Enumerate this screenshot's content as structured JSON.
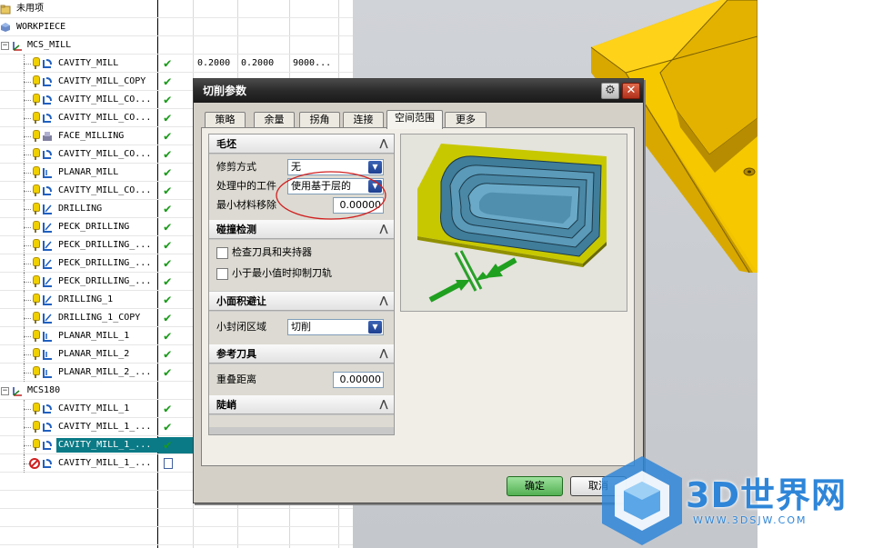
{
  "navigator": {
    "rows": [
      {
        "name": "未用项",
        "type": "folder",
        "indent": 0
      },
      {
        "name": "WORKPIECE",
        "type": "workpiece",
        "indent": 0
      },
      {
        "name": "MCS_MILL",
        "type": "mcs",
        "indent": 0,
        "expander": "−"
      },
      {
        "name": "CAVITY_MILL",
        "type": "cavity",
        "indent": 2,
        "check": "✔",
        "v1": "0.2000",
        "v2": "0.2000",
        "v3": "9000..."
      },
      {
        "name": "CAVITY_MILL_COPY",
        "type": "cavity",
        "indent": 2,
        "check": "✔"
      },
      {
        "name": "CAVITY_MILL_CO...",
        "type": "cavity",
        "indent": 2,
        "check": "✔"
      },
      {
        "name": "CAVITY_MILL_CO...",
        "type": "cavity",
        "indent": 2,
        "check": "✔"
      },
      {
        "name": "FACE_MILLING",
        "type": "face",
        "indent": 2,
        "check": "✔"
      },
      {
        "name": "CAVITY_MILL_CO...",
        "type": "cavity",
        "indent": 2,
        "check": "✔"
      },
      {
        "name": "PLANAR_MILL",
        "type": "planar",
        "indent": 2,
        "check": "✔"
      },
      {
        "name": "CAVITY_MILL_CO...",
        "type": "cavity",
        "indent": 2,
        "check": "✔"
      },
      {
        "name": "DRILLING",
        "type": "drill",
        "indent": 2,
        "check": "✔"
      },
      {
        "name": "PECK_DRILLING",
        "type": "drill",
        "indent": 2,
        "check": "✔"
      },
      {
        "name": "PECK_DRILLING_...",
        "type": "drill",
        "indent": 2,
        "check": "✔"
      },
      {
        "name": "PECK_DRILLING_...",
        "type": "drill",
        "indent": 2,
        "check": "✔"
      },
      {
        "name": "PECK_DRILLING_...",
        "type": "drill",
        "indent": 2,
        "check": "✔"
      },
      {
        "name": "DRILLING_1",
        "type": "drill",
        "indent": 2,
        "check": "✔"
      },
      {
        "name": "DRILLING_1_COPY",
        "type": "drill",
        "indent": 2,
        "check": "✔"
      },
      {
        "name": "PLANAR_MILL_1",
        "type": "planar",
        "indent": 2,
        "check": "✔"
      },
      {
        "name": "PLANAR_MILL_2",
        "type": "planar",
        "indent": 2,
        "check": "✔"
      },
      {
        "name": "PLANAR_MILL_2_...",
        "type": "planar",
        "indent": 2,
        "check": "✔"
      },
      {
        "name": "MCS180",
        "type": "mcs",
        "indent": 0,
        "expander": "−"
      },
      {
        "name": "CAVITY_MILL_1",
        "type": "cavity",
        "indent": 2,
        "check": "✔"
      },
      {
        "name": "CAVITY_MILL_1_...",
        "type": "cavity",
        "indent": 2,
        "check": "✔"
      },
      {
        "name": "CAVITY_MILL_1_...",
        "type": "cavity",
        "indent": 2,
        "check": "✔",
        "selected": true
      },
      {
        "name": "CAVITY_MILL_1_...",
        "type": "cavity",
        "indent": 2,
        "status": "blocked",
        "unchecked": true
      }
    ]
  },
  "dialog": {
    "title": "切削参数",
    "gear_icon": "⚙",
    "close_icon": "✕",
    "tabs": [
      {
        "label": "策略"
      },
      {
        "label": "余量"
      },
      {
        "label": "拐角"
      },
      {
        "label": "连接"
      },
      {
        "label": "空间范围",
        "active": true
      },
      {
        "label": "更多"
      }
    ],
    "groups": {
      "blank": {
        "title": "毛坯",
        "trim_label": "修剪方式",
        "trim_value": "无",
        "ipw_label": "处理中的工件",
        "ipw_value": "使用基于层的",
        "min_removal_label": "最小材料移除",
        "min_removal_value": "0.00000"
      },
      "collision": {
        "title": "碰撞检测",
        "check_holder_label": "检查刀具和夹持器",
        "suppress_label": "小于最小值时抑制刀轨"
      },
      "small_area": {
        "title": "小面积避让",
        "closed_label": "小封闭区域",
        "closed_value": "切削"
      },
      "ref_tool": {
        "title": "参考刀具",
        "overlap_label": "重叠距离",
        "overlap_value": "0.00000"
      },
      "steep": {
        "title": "陡峭"
      }
    },
    "collapse_glyph": "⋀",
    "dropdown_glyph": "▼",
    "ok_label": "确定",
    "cancel_label": "取消"
  },
  "watermark": {
    "brand": "3D世界网",
    "url": "WWW.3DSJW.COM"
  },
  "colors": {
    "selection": "#0a7a86",
    "check": "#1a9a1a",
    "part_yellow": "#f2c400",
    "annotation": "#d02020",
    "watermark_blue": "#2f86d8"
  }
}
